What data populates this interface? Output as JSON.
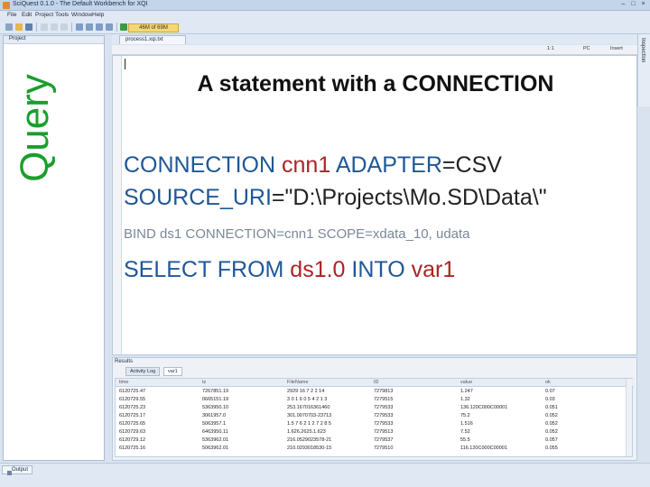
{
  "window": {
    "title": "SciQuest 0.1.0 - The Default Workbench for XQI"
  },
  "menu": [
    "File",
    "Edit",
    "Project",
    "Tools",
    "Window",
    "Help"
  ],
  "toolbar": {
    "memory": "46M of 69M"
  },
  "project_panel": {
    "label": "Project"
  },
  "side_label": "Query",
  "editor": {
    "tab_label": "process1.xqi.txt",
    "status": {
      "pos": "1:1",
      "mode": "PC",
      "insert": "Insert"
    },
    "slide_title": "A statement with a CONNECTION",
    "line1": {
      "kw1": "CONNECTION",
      "id1": "cnn1",
      "kw2": "ADAPTER",
      "eq": "=",
      "val": "CSV"
    },
    "line2": {
      "kw": "SOURCE_URI",
      "eq": "=",
      "val": "\"D:\\Projects\\Mo.SD\\Data\\\""
    },
    "line3": "BIND ds1 CONNECTION=cnn1 SCOPE=xdata_10, udata",
    "line4": {
      "kw1": "SELECT FROM",
      "id": "ds1.0",
      "kw2": "INTO",
      "var": "var1"
    }
  },
  "inspection_label": "Inspection",
  "results": {
    "label": "Results",
    "tabs": [
      "Activity Log",
      "var1"
    ],
    "columns": [
      "time",
      "tz",
      "FileName",
      "ID",
      "value",
      "ok"
    ],
    "rows": [
      [
        "6120725.47",
        "7267851.19",
        "2929 16 7 2 2 14",
        "7279813",
        "1.247",
        "0.07"
      ],
      [
        "6120729.55",
        "0665151.19",
        "3 0 1 6 0 5 4 2 1 3",
        "7279515",
        "1.32",
        "0.03"
      ],
      [
        "6120725.23",
        "5363950.10",
        "253.167016361460",
        "7279533",
        "136.120C000C00001",
        "0.051"
      ],
      [
        "6120725.17",
        "3061957.0",
        "301.0070703-23713",
        "7279533",
        "75.2",
        "0.052"
      ],
      [
        "6120725.65",
        "5063957.1",
        "1.5 7 6 2 1 2 7 2 8 5",
        "7279533",
        "1.516",
        "0.052"
      ],
      [
        "6120729.63",
        "6463950.11",
        "1.626.2625.1.623",
        "7279513",
        "7.52",
        "0.052"
      ],
      [
        "6120729.12",
        "5363962.01",
        "216.0529023578-21",
        "7279537",
        "55.5",
        "0.057"
      ],
      [
        "6120725.16",
        "5063962.01",
        "210.0293018530-15",
        "7279510",
        "116.120C000C00001",
        "0.055"
      ]
    ]
  },
  "output_label": "Output",
  "colors": {
    "query_green": "#1a9e2c",
    "keyword_blue": "#1f5796",
    "identifier_red": "#a82525",
    "chrome_blue": "#dfe8f3"
  }
}
